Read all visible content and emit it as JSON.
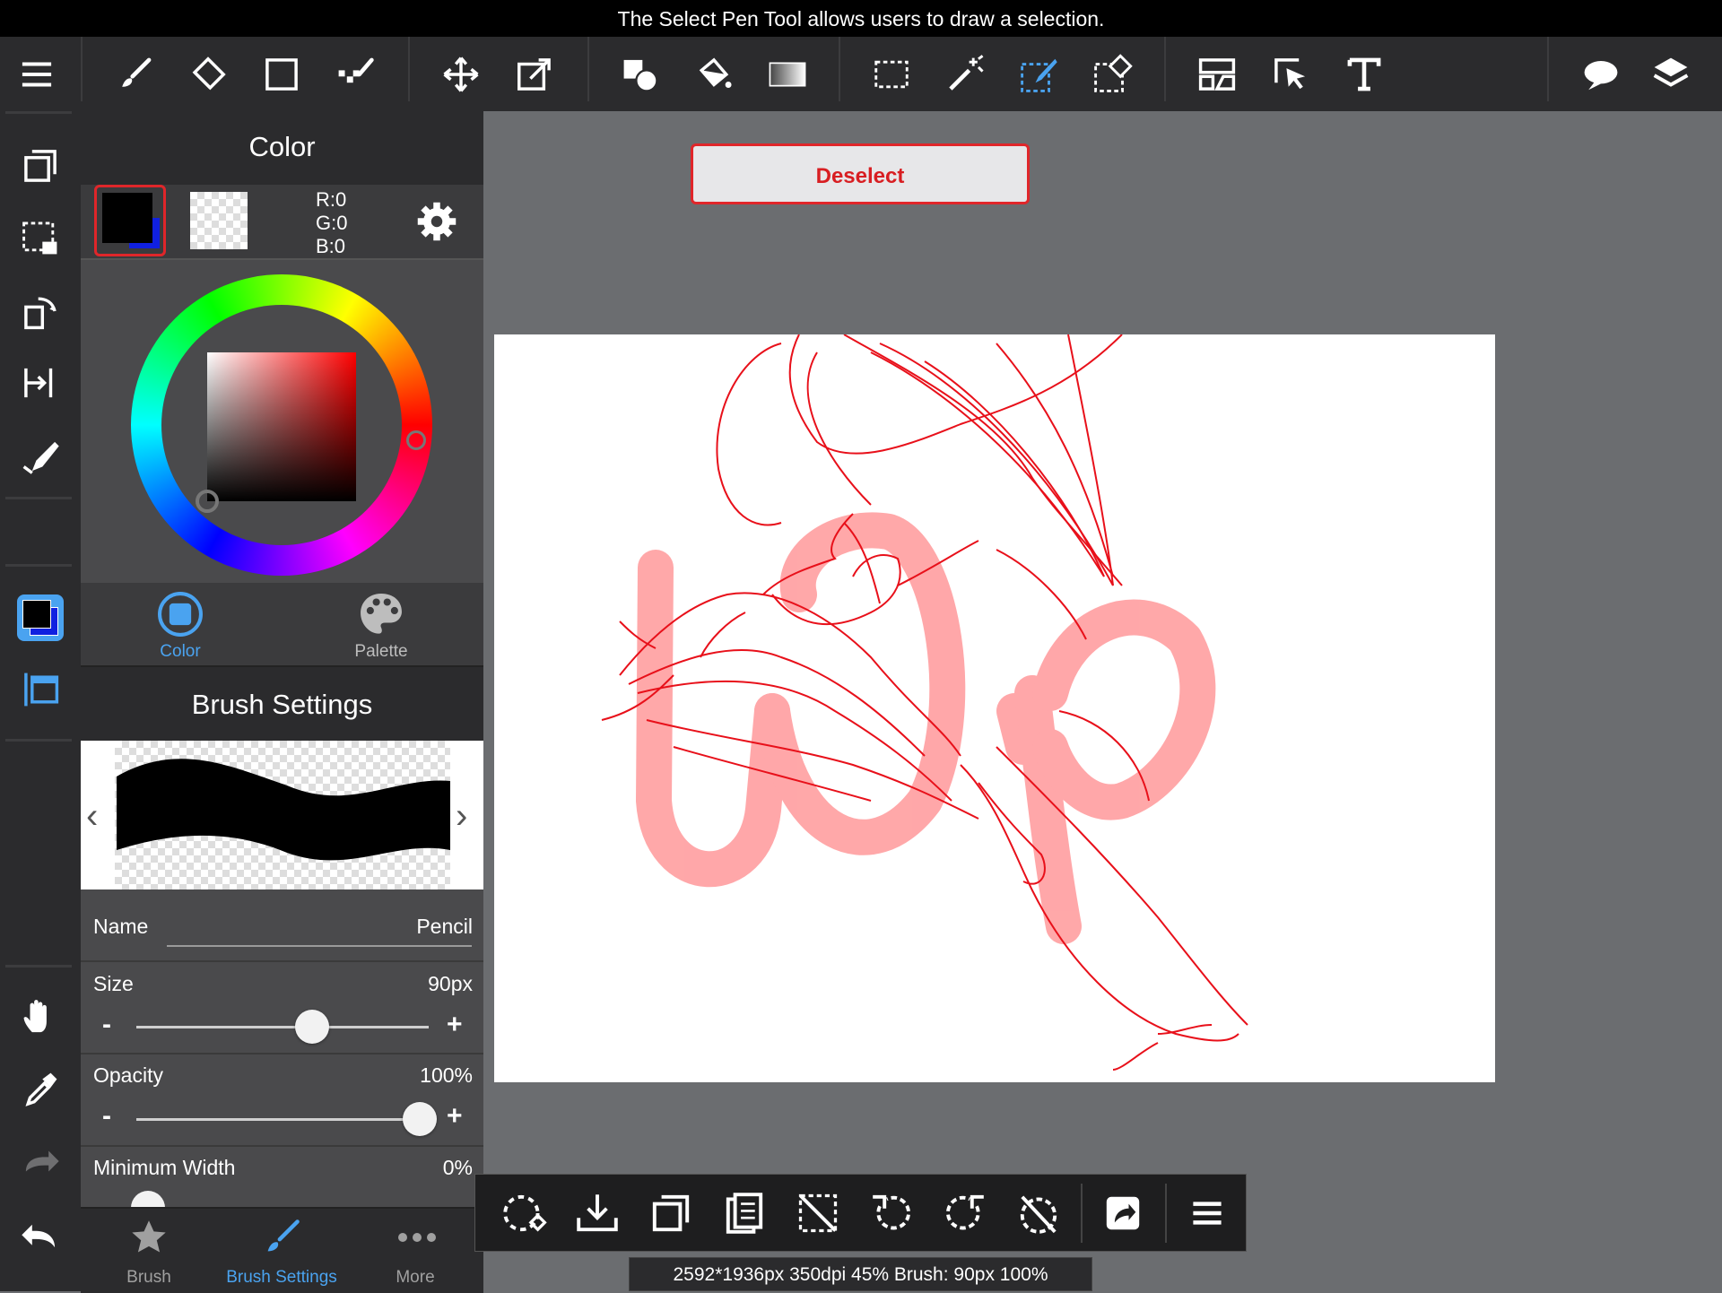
{
  "caption": "The Select Pen Tool allows users to draw a selection.",
  "toolbar": {
    "items": [
      "menu-icon",
      "brush-icon",
      "eraser-icon",
      "shape-icon",
      "dot-brush-icon",
      "move-icon",
      "transform-icon",
      "fill-shape-icon",
      "bucket-icon",
      "gradient-icon",
      "select-rect-icon",
      "magic-wand-icon",
      "select-pen-icon",
      "select-eraser-icon",
      "frame-divider-icon",
      "object-select-icon",
      "text-icon",
      "speech-bubble-icon",
      "layers-icon"
    ],
    "active_tool": "select-pen-icon"
  },
  "color_panel": {
    "title": "Color",
    "rgb": {
      "r": "R:0",
      "g": "G:0",
      "b": "B:0"
    },
    "primary_color": "#000000",
    "secondary_color": "#1020e0",
    "tabs": [
      {
        "label": "Color"
      },
      {
        "label": "Palette"
      }
    ]
  },
  "brush_settings": {
    "title": "Brush Settings",
    "name_label": "Name",
    "name_value": "Pencil",
    "size_label": "Size",
    "size_value": "90px",
    "size_level": 0.6,
    "opacity_label": "Opacity",
    "opacity_value": "100%",
    "opacity_level": 1.0,
    "minwidth_label": "Minimum Width",
    "minwidth_value": "0%",
    "minus": "-",
    "plus": "+"
  },
  "bottom_tabs": [
    {
      "label": "Brush"
    },
    {
      "label": "Brush Settings"
    },
    {
      "label": "More"
    }
  ],
  "deselect_label": "Deselect",
  "status_text": "2592*1936px 350dpi 45% Brush: 90px 100%",
  "accent_color": "#4aa3f0",
  "sketch_color": "#e8101a",
  "wip_color": "#ff9ea0"
}
